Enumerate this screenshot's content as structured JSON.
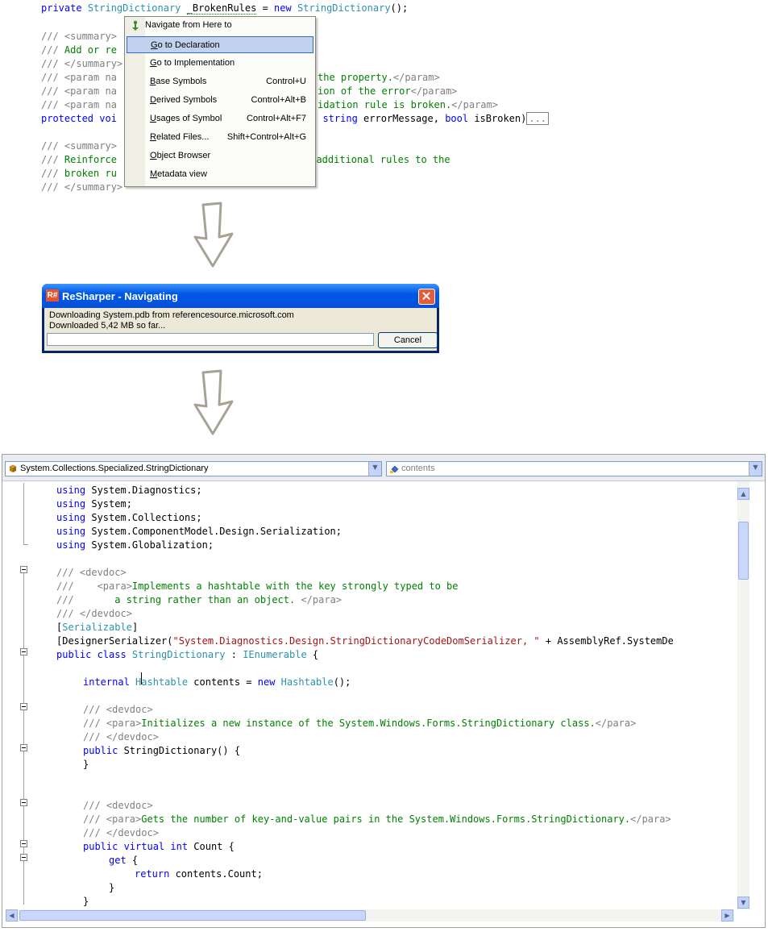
{
  "top_code": {
    "line1": {
      "kw1": "private",
      "type1": "StringDictionary",
      "ident": "_BrokenRules",
      "op": " = ",
      "kw2": "new",
      "type2": "StringDictionary",
      "tail": "();"
    },
    "lines": [
      {
        "prefix": "/// ",
        "rest": "<summary>",
        "color": "gr"
      },
      {
        "prefix": "/// ",
        "rest": "Add or re",
        "color": "cm"
      },
      {
        "prefix": "/// ",
        "rest": "</summary>",
        "color": "gr"
      },
      {
        "prefix": "/// ",
        "rest": "<param na",
        "color": "gr"
      },
      {
        "prefix": "/// ",
        "rest": "<param na",
        "color": "gr"
      },
      {
        "prefix": "/// ",
        "rest": "<param na",
        "color": "gr"
      }
    ],
    "right_fragments": {
      "r1a": "the property.",
      "r1b": "</param>",
      "r2a": "ion of the error",
      "r2b": "</param>",
      "r3a": "idation rule is broken.",
      "r3b": "</param>"
    },
    "protected_line": {
      "kw1": "protected",
      "kw2": " voi",
      "mid": ", ",
      "kw3": "string",
      "mid2": " errorMessage, ",
      "kw4": "bool",
      "tail": " isBroken)",
      "ellipsis": "..."
    },
    "lines2": [
      {
        "prefix": "/// ",
        "rest": "<summary>",
        "color": "gr"
      },
      {
        "prefix": "/// ",
        "rest": "Reinforce",
        "color": "cm"
      },
      {
        "prefix": "/// ",
        "rest": "broken ru",
        "color": "cm"
      },
      {
        "prefix": "/// ",
        "rest": "</summary>",
        "color": "gr"
      }
    ],
    "right_fragment2": "g additional rules to the"
  },
  "context_menu": {
    "header": "Navigate from Here to",
    "items": [
      {
        "label": "Go to Declaration",
        "shortcut": ""
      },
      {
        "label": "Go to Implementation",
        "shortcut": ""
      },
      {
        "label": "Base Symbols",
        "shortcut": "Control+U"
      },
      {
        "label": "Derived Symbols",
        "shortcut": "Control+Alt+B"
      },
      {
        "label": "Usages of Symbol",
        "shortcut": "Control+Alt+F7"
      },
      {
        "label": "Related Files...",
        "shortcut": "Shift+Control+Alt+G"
      },
      {
        "label": "Object Browser",
        "shortcut": ""
      },
      {
        "label": "Metadata view",
        "shortcut": ""
      }
    ]
  },
  "dialog": {
    "title": "ReSharper - Navigating",
    "logo": "R#",
    "line1": "Downloading System.pdb from referencesource.microsoft.com",
    "line2": "Downloaded 5,42 MB so far...",
    "cancel": "Cancel",
    "progress": 0.0
  },
  "editor": {
    "type_combo": "System.Collections.Specialized.StringDictionary",
    "member_combo": "contents",
    "code": {
      "u1": {
        "kw": "using",
        "rest": " System.Diagnostics;"
      },
      "u2": {
        "kw": "using",
        "rest": " System;"
      },
      "u3": {
        "kw": "using",
        "rest": " System.Collections;"
      },
      "u4": {
        "kw": "using",
        "rest": " System.ComponentModel.Design.Serialization;"
      },
      "u5": {
        "kw": "using",
        "rest": " System.Globalization;"
      },
      "d1": {
        "g": "/// <devdoc>"
      },
      "d2": {
        "g": "///    <para>",
        "c": "Implements a hashtable with the key strongly typed to be"
      },
      "d3": {
        "g": "///",
        "c": "       a string rather than an object. ",
        "g2": "</para>"
      },
      "d4": {
        "g": "/// </devdoc>"
      },
      "a1": {
        "p1": "[",
        "t": "Serializable",
        "p2": "]"
      },
      "a2": {
        "p1": "[DesignerSerializer(",
        "s": "\"System.Diagnostics.Design.StringDictionaryCodeDomSerializer, \"",
        "p2": " + AssemblyRef.SystemDe"
      },
      "c1": {
        "kw": "public class ",
        "t": "StringDictionary",
        "mid": " : ",
        "t2": "IEnumerable",
        "tail": " {"
      },
      "f1": {
        "kw": "internal ",
        "t": "Hashtable",
        "mid": " contents = ",
        "kw2": "new ",
        "t2": "Hashtable",
        "tail": "();"
      },
      "e1": {
        "g": "/// <devdoc>"
      },
      "e2": {
        "g": "/// <para>",
        "c": "Initializes a new instance of the System.Windows.Forms.StringDictionary class.",
        "g2": "</para>"
      },
      "e3": {
        "g": "/// </devdoc>"
      },
      "m1": {
        "kw": "public",
        "rest": " StringDictionary() {"
      },
      "m2": {
        "rest": "}"
      },
      "h1": {
        "g": "/// <devdoc>"
      },
      "h2": {
        "g": "/// <para>",
        "c": "Gets the number of key-and-value pairs in the System.Windows.Forms.StringDictionary.",
        "g2": "</para>"
      },
      "h3": {
        "g": "/// </devdoc>"
      },
      "p1": {
        "kw": "public virtual int",
        "rest": " Count {"
      },
      "p2": {
        "kw": "get",
        "rest": " {"
      },
      "p3": {
        "kw": "return",
        "rest": " contents.Count;"
      },
      "p4": {
        "rest": "}"
      },
      "p5": {
        "rest": "}"
      }
    }
  },
  "colors": {
    "keyword": "#0000ff",
    "type": "#2b91af",
    "comment": "#008000",
    "xmldoc": "#808080",
    "string": "#a31515",
    "menu_highlight": "#c1d2ee",
    "titlebar": "#0054e3"
  },
  "icons": {
    "menu_header": "navigate-arrow-icon",
    "type_combo": "class-icon",
    "member_combo": "field-icon",
    "dialog_close": "close-icon",
    "arrow": "down-arrow-icon"
  }
}
